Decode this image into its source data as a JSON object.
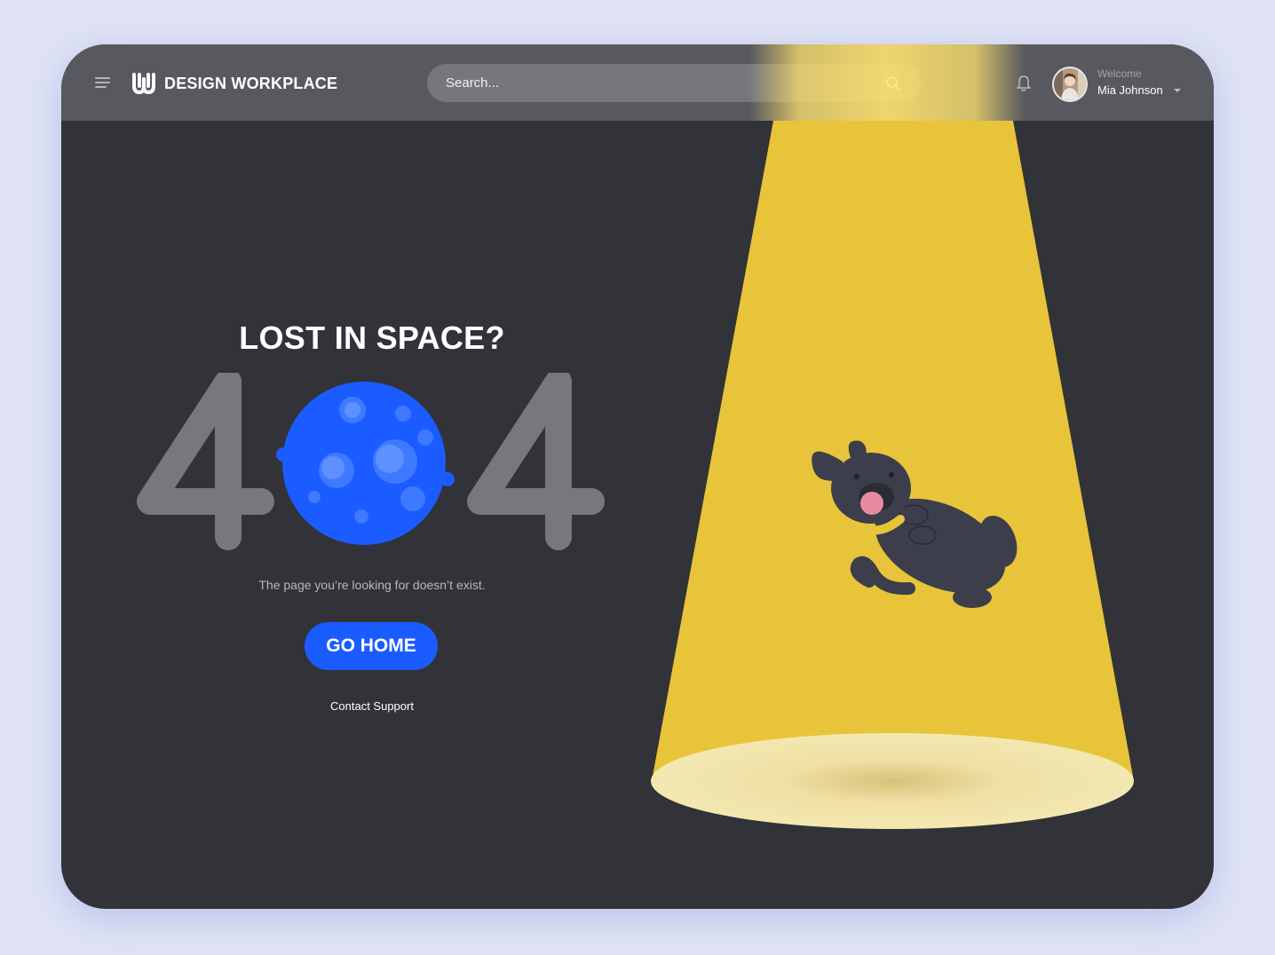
{
  "header": {
    "brand": "DESIGN WORKPLACE",
    "search_placeholder": "Search...",
    "welcome_label": "Welcome",
    "user_name": "Mia Johnson"
  },
  "error": {
    "headline": "LOST IN SPACE?",
    "code": "404",
    "message": "The page you’re looking for doesn’t exist.",
    "primary_action": "GO HOME",
    "secondary_action": "Contact Support"
  },
  "colors": {
    "background": "#dfe3f4",
    "window": "#323338",
    "topbar": "#58595e",
    "accent_blue": "#1a5cff",
    "beam_yellow": "#e8c43a",
    "digit_gray": "#77787c"
  },
  "icons": {
    "menu": "hamburger-menu-icon",
    "logo": "design-workplace-logo-icon",
    "search": "search-icon",
    "notifications": "bell-icon",
    "dropdown": "chevron-down-icon",
    "moon": "moon-icon",
    "dog": "floating-dog-illustration"
  }
}
